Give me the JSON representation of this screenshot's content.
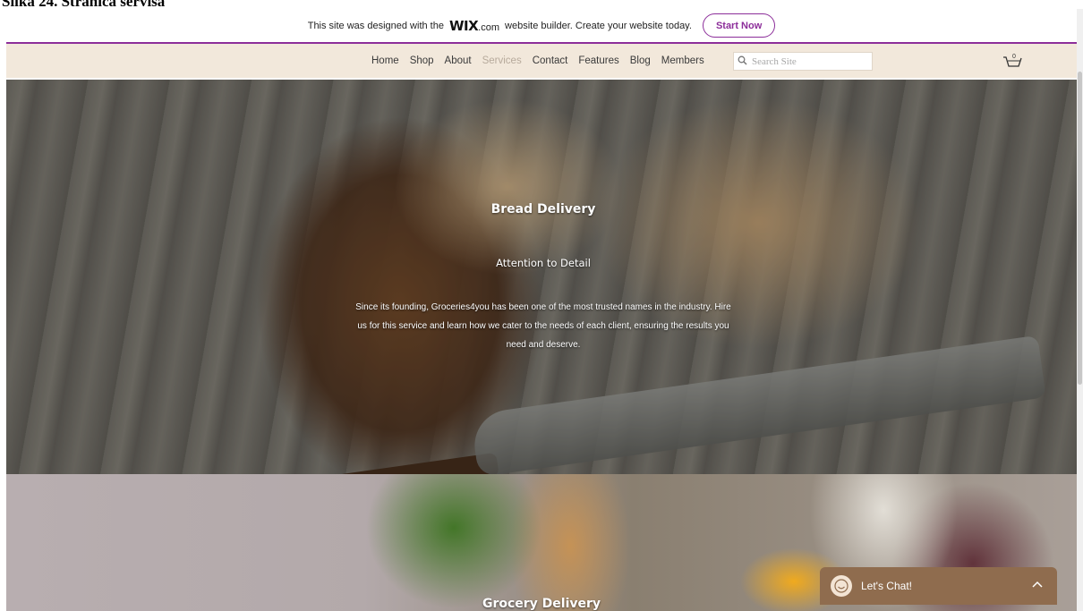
{
  "document_caption": "Slika 24. Stranica servisa",
  "wix_banner": {
    "text_before": "This site was designed with the",
    "logo": "WIX",
    "logo_suffix": ".com",
    "text_after": "website builder. Create your website today.",
    "cta_label": "Start Now"
  },
  "nav": {
    "items": [
      "Home",
      "Shop",
      "About",
      "Services",
      "Contact",
      "Features",
      "Blog",
      "Members"
    ],
    "active": "Services",
    "search_placeholder": "Search Site",
    "cart_count": "0"
  },
  "hero": {
    "title": "Bread Delivery",
    "subtitle": "Attention to Detail",
    "body": "Since its founding, Groceries4you has been one of the most trusted names in the industry. Hire us for this service and learn how we cater to the needs of each client, ensuring the results you need and deserve."
  },
  "grocery": {
    "title": "Grocery Delivery"
  },
  "chat": {
    "label": "Let's Chat!"
  },
  "colors": {
    "wix_accent": "#8c2e9a",
    "nav_bg": "#f2e8db",
    "nav_active": "#b7aa9c",
    "chat_bg": "#8f6c4e"
  }
}
